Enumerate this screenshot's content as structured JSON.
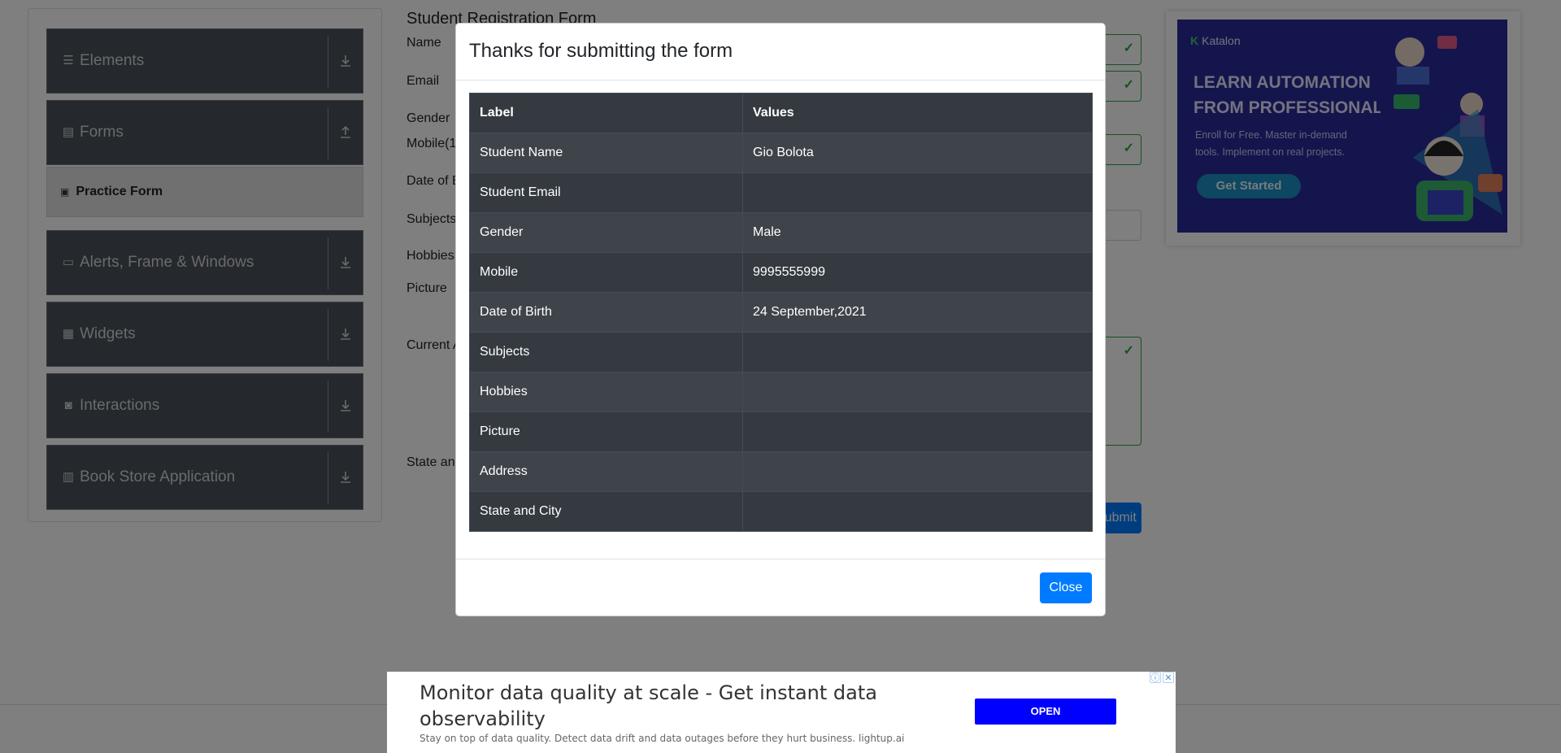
{
  "sidebar": {
    "groups": [
      {
        "label": "Elements",
        "icon": "hamburger-icon",
        "arrow": "download-icon"
      },
      {
        "label": "Forms",
        "icon": "document-icon",
        "arrow": "upload-icon"
      },
      {
        "label": "Alerts, Frame & Windows",
        "icon": "window-icon",
        "arrow": "download-icon"
      },
      {
        "label": "Widgets",
        "icon": "grid-icon",
        "arrow": "download-icon"
      },
      {
        "label": "Interactions",
        "icon": "interaction-icon",
        "arrow": "download-icon"
      },
      {
        "label": "Book Store Application",
        "icon": "books-icon",
        "arrow": "download-icon"
      }
    ],
    "active_item": "Practice Form"
  },
  "form": {
    "title": "Student Registration Form",
    "labels": {
      "name": "Name",
      "email": "Email",
      "gender": "Gender",
      "mobile": "Mobile(1",
      "dob": "Date of B",
      "subjects": "Subjects",
      "hobbies": "Hobbies",
      "picture": "Picture",
      "address": "Current A",
      "state": "State and"
    },
    "submit_label": "Submit"
  },
  "ad_right": {
    "brand": "Katalon",
    "headline": "LEARN AUTOMATION FROM PROFESSIONALS",
    "sub": "Enroll for Free. Master in-demand tools. Implement on real projects.",
    "cta": "Get Started"
  },
  "modal": {
    "title": "Thanks for submitting the form",
    "columns": [
      "Label",
      "Values"
    ],
    "rows": [
      {
        "label": "Student Name",
        "value": "Gio Bolota"
      },
      {
        "label": "Student Email",
        "value": ""
      },
      {
        "label": "Gender",
        "value": "Male"
      },
      {
        "label": "Mobile",
        "value": "9995555999"
      },
      {
        "label": "Date of Birth",
        "value": "24 September,2021"
      },
      {
        "label": "Subjects",
        "value": ""
      },
      {
        "label": "Hobbies",
        "value": ""
      },
      {
        "label": "Picture",
        "value": ""
      },
      {
        "label": "Address",
        "value": ""
      },
      {
        "label": "State and City",
        "value": ""
      }
    ],
    "close_label": "Close"
  },
  "bottom_ad": {
    "headline": "Monitor data quality at scale - Get instant data observability",
    "sub": "Stay on top of data quality. Detect data drift and data outages before they hurt business. lightup.ai",
    "button": "OPEN"
  },
  "colors": {
    "overlay": "#000000",
    "primary": "#007bff",
    "table_dark": "#343a40",
    "valid": "#28a745"
  }
}
